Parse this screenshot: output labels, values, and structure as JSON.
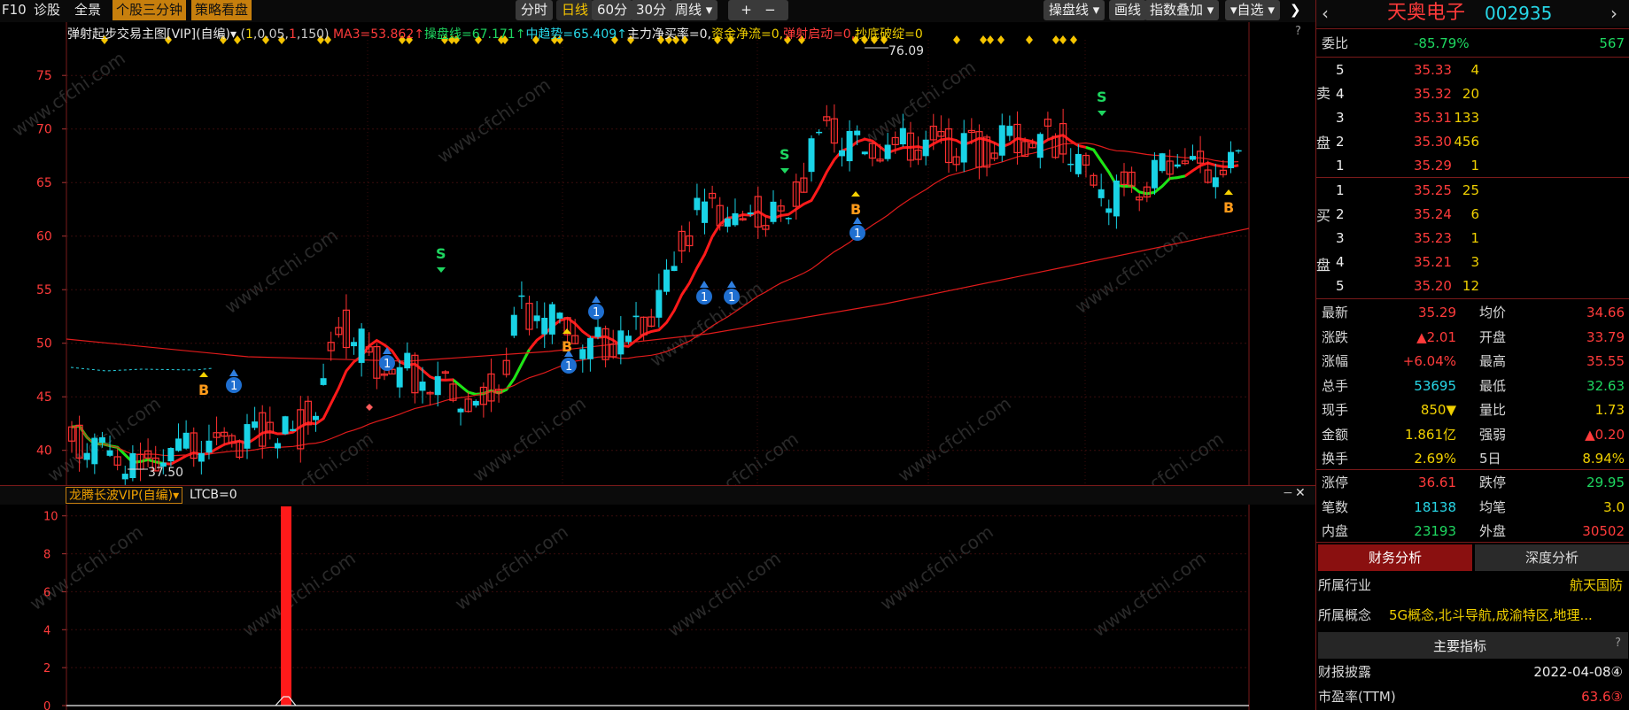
{
  "toolbar": {
    "f10": "F10",
    "diagnose": "诊股",
    "full_view": "全景",
    "stock_3min": "个股三分钟",
    "strategy": "策略看盘",
    "timeshare": "分时",
    "daily": "日线",
    "min60": "60分",
    "min30": "30分",
    "weekly": "周线",
    "plus": "+",
    "minus": "−",
    "trade_line": "操盘线",
    "draw_line": "画线",
    "overlay": "指数叠加",
    "self_select": "自选",
    "expand": "❯"
  },
  "indicator_bar": {
    "name": "弹射起步交易主图[VIP](自编)",
    "params_open": "(",
    "p1": "1",
    "p2": ",0.05,",
    "p3": "1",
    "p4": ",150)",
    "ma3": "MA3=53.862↑",
    "trade_line": "操盘线=67.171↑",
    "mid_trend": "中趋势=65.409↑",
    "main_flow": "主力净买率=0,",
    "fund_flow": "资金净流=0,",
    "launch": "弹射启动=0,",
    "bottom": "抄底破绽=0",
    "help": "?"
  },
  "chart_data": {
    "type": "candlestick",
    "ylim": [
      37,
      77
    ],
    "y_ticks": [
      "75",
      "70",
      "65",
      "60",
      "55",
      "50",
      "45",
      "40"
    ],
    "high_label": "76.09",
    "low_label": "37.50",
    "sub_indicator": {
      "name": "龙腾长波VIP(自编)",
      "value_label": "LTCB=0",
      "y_ticks": [
        "10",
        "8",
        "6",
        "4",
        "2",
        "0"
      ],
      "ylim": [
        0,
        10.5
      ]
    }
  },
  "sub_header": {
    "name": "龙腾长波VIP(自编)",
    "value": "LTCB=0",
    "minus": "−",
    "close": "✕"
  },
  "watermark": "www.cfchi.com",
  "panel": {
    "name": "天奥电子",
    "code": "002935",
    "wei_bi_label": "委比",
    "wei_bi": "-85.79%",
    "wei_cha": "567",
    "sell_side": "卖",
    "sell_side2": "盘",
    "buy_side": "买",
    "buy_side2": "盘",
    "asks": [
      {
        "lv": "5",
        "price": "35.33",
        "vol": "4"
      },
      {
        "lv": "4",
        "price": "35.32",
        "vol": "20"
      },
      {
        "lv": "3",
        "price": "35.31",
        "vol": "133"
      },
      {
        "lv": "2",
        "price": "35.30",
        "vol": "456"
      },
      {
        "lv": "1",
        "price": "35.29",
        "vol": "1"
      }
    ],
    "bids": [
      {
        "lv": "1",
        "price": "35.25",
        "vol": "25"
      },
      {
        "lv": "2",
        "price": "35.24",
        "vol": "6"
      },
      {
        "lv": "3",
        "price": "35.23",
        "vol": "1"
      },
      {
        "lv": "4",
        "price": "35.21",
        "vol": "3"
      },
      {
        "lv": "5",
        "price": "35.20",
        "vol": "12"
      }
    ],
    "stats": [
      {
        "l1": "最新",
        "v1": "35.29",
        "c1": "red",
        "l2": "均价",
        "v2": "34.66",
        "c2": "red"
      },
      {
        "l1": "涨跌",
        "v1": "▲2.01",
        "c1": "red",
        "l2": "开盘",
        "v2": "33.79",
        "c2": "red"
      },
      {
        "l1": "涨幅",
        "v1": "+6.04%",
        "c1": "red",
        "l2": "最高",
        "v2": "35.55",
        "c2": "red"
      },
      {
        "l1": "总手",
        "v1": "53695",
        "c1": "cyan",
        "l2": "最低",
        "v2": "32.63",
        "c2": "green"
      },
      {
        "l1": "现手",
        "v1": "850▼",
        "c1": "yel",
        "l2": "量比",
        "v2": "1.73",
        "c2": "yel"
      },
      {
        "l1": "金额",
        "v1": "1.861亿",
        "c1": "yel",
        "l2": "强弱",
        "v2": "▲0.20",
        "c2": "red"
      },
      {
        "l1": "换手",
        "v1": "2.69%",
        "c1": "yel",
        "l2": "5日",
        "v2": "8.94%",
        "c2": "yel"
      }
    ],
    "limit": [
      {
        "l1": "涨停",
        "v1": "36.61",
        "c1": "red",
        "l2": "跌停",
        "v2": "29.95",
        "c2": "green"
      },
      {
        "l1": "笔数",
        "v1": "18138",
        "c1": "cyan",
        "l2": "均笔",
        "v2": "3.0",
        "c2": "yel"
      },
      {
        "l1": "内盘",
        "v1": "23193",
        "c1": "green",
        "l2": "外盘",
        "v2": "30502",
        "c2": "red"
      }
    ],
    "tab_finance": "财务分析",
    "tab_depth": "深度分析",
    "industry_label": "所属行业",
    "industry": "航天国防",
    "concept_label": "所属概念",
    "concept": "5G概念,北斗导航,成渝特区,地理...",
    "key_metrics": "主要指标",
    "help": "?",
    "report_label": "财报披露",
    "report": "2022-04-08④",
    "pe_label": "市盈率(TTM)",
    "pe": "63.6③"
  },
  "colors": {
    "up": "#ff3030",
    "down": "#19d3e6",
    "ma": "#ff1a1a",
    "trend_green": "#17e817",
    "panel_border": "#7a1a1a"
  }
}
